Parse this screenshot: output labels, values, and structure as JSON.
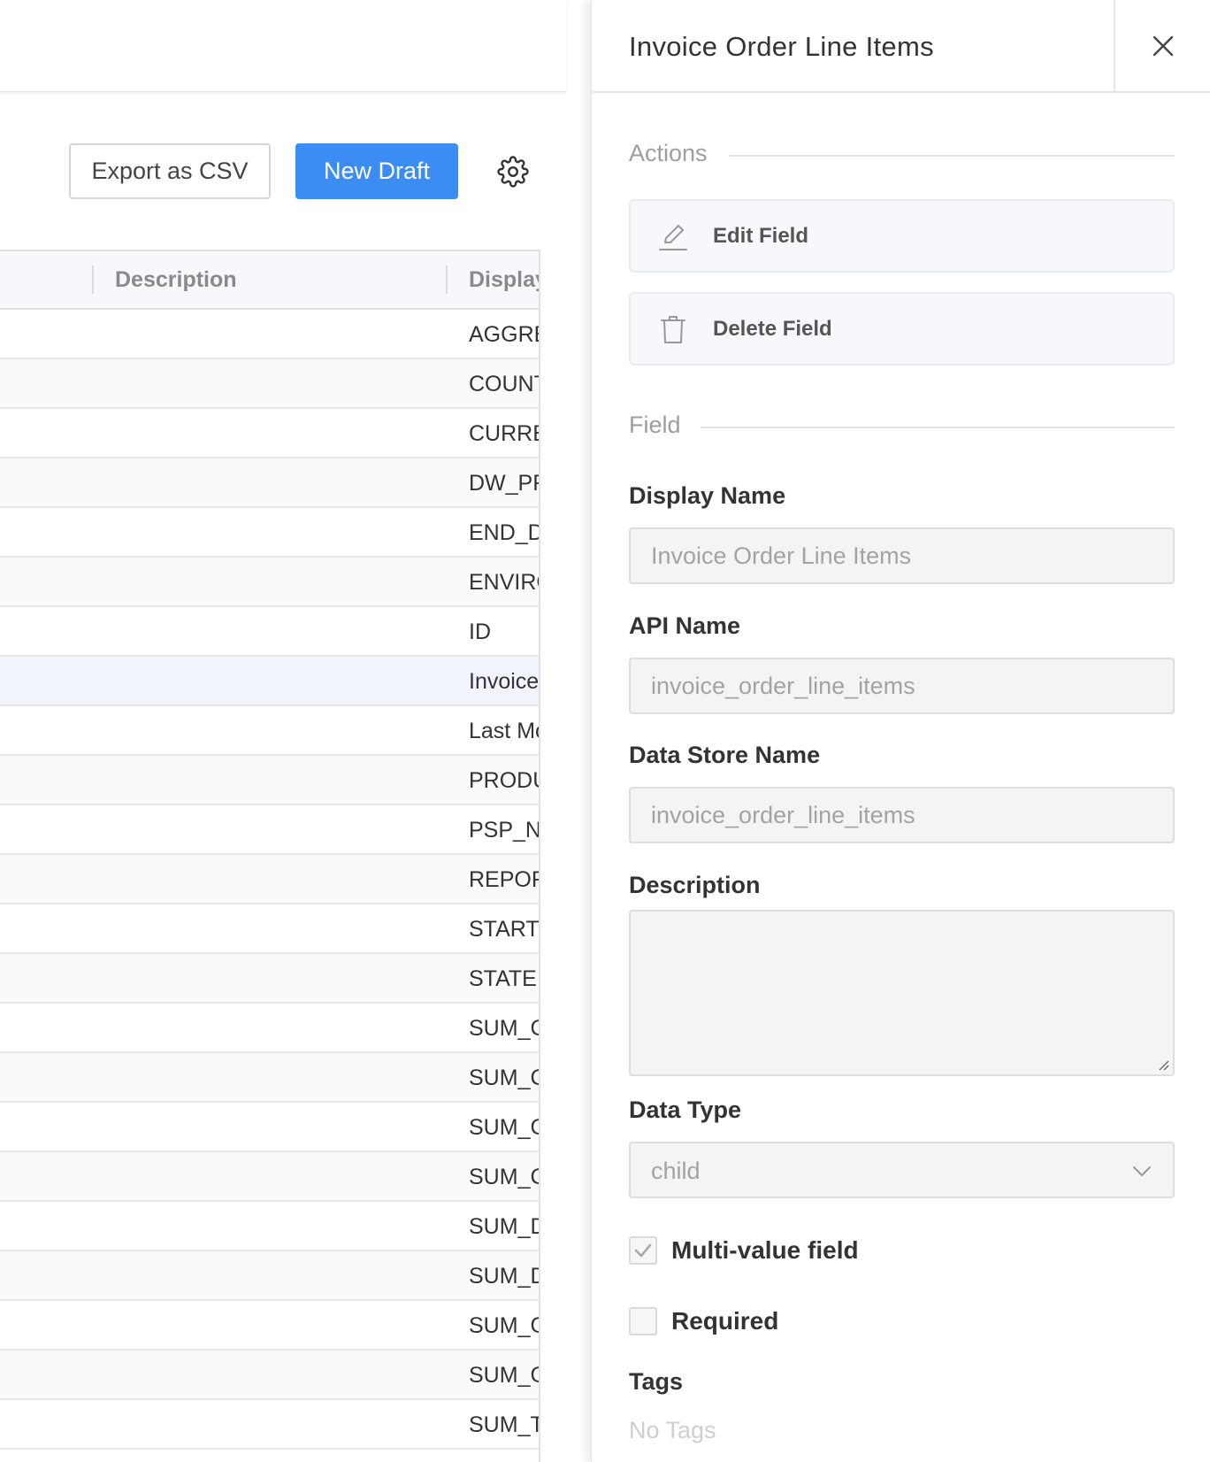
{
  "toolbar": {
    "export_label": "Export as CSV",
    "new_draft_label": "New Draft",
    "settings_icon": "gear-icon"
  },
  "table": {
    "columns": {
      "description": "Description",
      "display": "Display"
    },
    "rows": [
      "AGGRE",
      "COUNT",
      "CURRE",
      "DW_PF",
      "END_D",
      "ENVIRO",
      "ID",
      "Invoice",
      "Last Mo",
      "PRODU",
      "PSP_NA",
      "REPOR",
      "START_",
      "STATE",
      "SUM_C",
      "SUM_C",
      "SUM_C",
      "SUM_C",
      "SUM_D",
      "SUM_D",
      "SUM_G",
      "SUM_G",
      "SUM_T"
    ],
    "selected_index": 7
  },
  "panel": {
    "title": "Invoice Order Line Items",
    "actions_section": "Actions",
    "edit_label": "Edit Field",
    "delete_label": "Delete Field",
    "field_section": "Field",
    "display_name_label": "Display Name",
    "display_name_value": "Invoice Order Line Items",
    "api_name_label": "API Name",
    "api_name_value": "invoice_order_line_items",
    "data_store_label": "Data Store Name",
    "data_store_value": "invoice_order_line_items",
    "description_label": "Description",
    "data_type_label": "Data Type",
    "data_type_value": "child",
    "multi_value_label": "Multi-value field",
    "multi_value_checked": true,
    "required_label": "Required",
    "required_checked": false,
    "tags_label": "Tags",
    "tags_empty": "No Tags"
  },
  "colors": {
    "accent": "#3b8cf3",
    "row_selected": "#f1f5fb"
  }
}
